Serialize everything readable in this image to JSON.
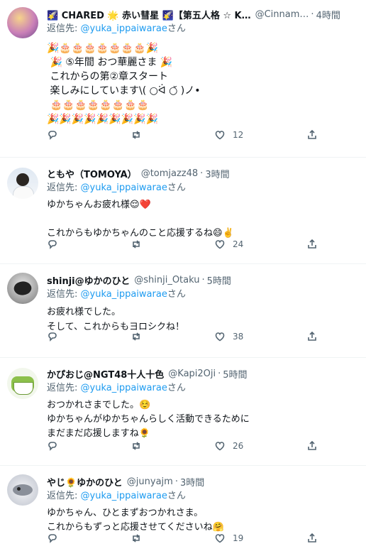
{
  "reply_prefix": "返信先: ",
  "reply_suffix": "さん",
  "tweets": [
    {
      "name": "🌠 CHARED 🌟 赤い彗星 🌠【第五人格 ☆ K…",
      "handle": "@Cinnam…",
      "time": "4時間",
      "reply_to": "@yuka_ippaiwarae",
      "text": "🎉🎂🎂🎂🎂🎂🎂🎂🎉\n 🎉 ⑤年間 おつ華麗さま 🎉\n これからの第②章スタート\n 楽しみにしています\\( ○ᐛ ○̆ )ノ•\n 🎂🎂🎂🎂🎂🎂🎂🎂\n🎉🎉🎉🎉🎉🎉🎉🎉🎉",
      "likes": "12"
    },
    {
      "name": "ともや（TOMOYA）",
      "handle": "@tomjazz48",
      "time": "3時間",
      "reply_to": "@yuka_ippaiwarae",
      "text": "ゆかちゃんお疲れ様😌❤️\n\nこれからもゆかちゃんのこと応援するね😄✌️",
      "likes": "24"
    },
    {
      "name": "shinji@ゆかのひと",
      "handle": "@shinji_Otaku",
      "time": "5時間",
      "reply_to": "@yuka_ippaiwarae",
      "text": "お疲れ様でした。\nそして、これからもヨロシクね！",
      "likes": "38"
    },
    {
      "name": "かぴおじ@NGT48十人十色",
      "handle": "@Kapi2Oji",
      "time": "5時間",
      "reply_to": "@yuka_ippaiwarae",
      "text": "おつかれさまでした。☺️\nゆかちゃんがゆかちゃんらしく活動できるために\nまだまだ応援しますね🌻",
      "likes": "26"
    },
    {
      "name": "やじ🌻ゆかのひと",
      "handle": "@junyajm",
      "time": "3時間",
      "reply_to": "@yuka_ippaiwarae",
      "text": "ゆかちゃん、ひとまずおつかれさま。\nこれからもずっと応援させてくださいね🤗",
      "likes": "19"
    }
  ]
}
